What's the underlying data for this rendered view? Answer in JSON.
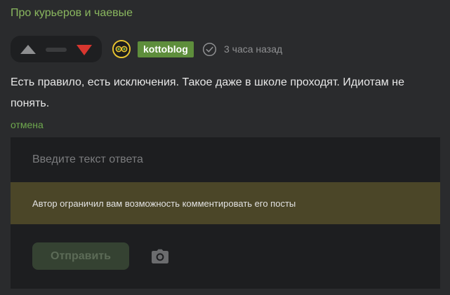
{
  "post": {
    "title": "Про курьеров и чаевые"
  },
  "comment": {
    "votes": {
      "up_icon": "triangle-up-icon",
      "down_icon": "triangle-down-icon",
      "up_color": "#8e8f91",
      "down_color": "#d8362f"
    },
    "author": {
      "username": "kottoblog",
      "avatar_icon": "avatar-icon",
      "verified_icon": "check-circle-icon"
    },
    "timestamp": "3 часа назад",
    "text": "Есть правило, есть исключения. Такое даже в школе проходят. Идиотам не понять.",
    "cancel_label": "отмена"
  },
  "reply": {
    "placeholder": "Введите текст ответа",
    "restriction_notice": "Автор ограничил вам возможность комментировать его посты",
    "submit_label": "Отправить",
    "camera_icon": "camera-icon"
  },
  "colors": {
    "accent_green": "#8ab75f",
    "username_bg": "#5e8e3c",
    "banner_bg": "#4b4628",
    "background": "#2a2b2d"
  }
}
